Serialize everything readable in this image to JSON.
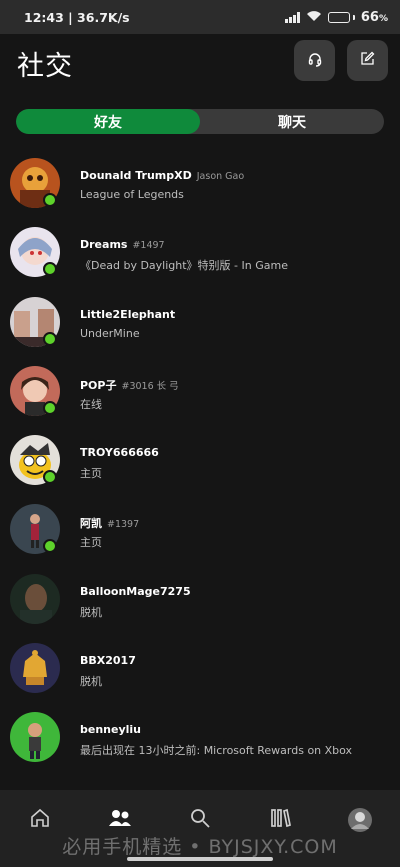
{
  "statusbar": {
    "time_speed": "12:43 | 36.7K/s",
    "battery_level": "66",
    "battery_unit": "%",
    "battery_fraction": 0.66
  },
  "header": {
    "title": "社交",
    "party_icon": "headset-icon",
    "compose_icon": "compose-icon"
  },
  "tabs": [
    {
      "label": "好友",
      "active": true
    },
    {
      "label": "聊天",
      "active": false
    }
  ],
  "colors": {
    "accent": "#0f8a3b",
    "online": "#5ed22b",
    "background": "#151515"
  },
  "friends": [
    {
      "gamertag": "Dounald TrumpXD",
      "realname": "Jason Gao",
      "status": "League of Legends",
      "online": true
    },
    {
      "gamertag": "Dreams",
      "realname": "#1497",
      "status": "《Dead by Daylight》特别版 - In Game",
      "online": true
    },
    {
      "gamertag": "Little2Elephant",
      "realname": "",
      "status": "UnderMine",
      "online": true
    },
    {
      "gamertag": "POP子",
      "realname": "#3016 长 弓",
      "status": "在线",
      "online": true
    },
    {
      "gamertag": "TROY666666",
      "realname": "",
      "status": "主页",
      "online": true
    },
    {
      "gamertag": "阿凯",
      "realname": "#1397",
      "status": "主页",
      "online": true
    },
    {
      "gamertag": "BalloonMage7275",
      "realname": "",
      "status": "脱机",
      "online": false
    },
    {
      "gamertag": "BBX2017",
      "realname": "",
      "status": "脱机",
      "online": false
    },
    {
      "gamertag": "benneyliu",
      "realname": "",
      "status": "最后出现在 13小时之前: Microsoft Rewards on Xbox",
      "online": false
    }
  ],
  "bottom_nav": [
    "home-icon",
    "friends-icon",
    "search-icon",
    "library-icon",
    "profile-avatar"
  ],
  "watermark": "必用手机精选 • BYJSJXY.COM"
}
